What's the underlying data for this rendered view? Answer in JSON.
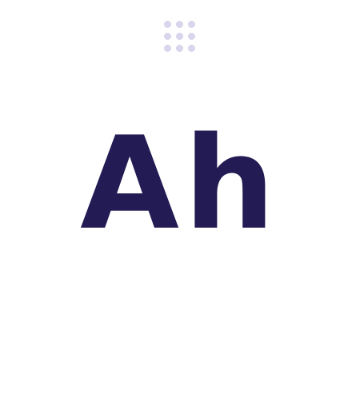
{
  "preview": {
    "text": "Ah"
  },
  "drag_handle": {
    "icon": "grip-dots-icon",
    "dots": 9
  },
  "colors": {
    "ink": "#231b53",
    "dot": "#d8d5ec",
    "background": "#ffffff"
  }
}
